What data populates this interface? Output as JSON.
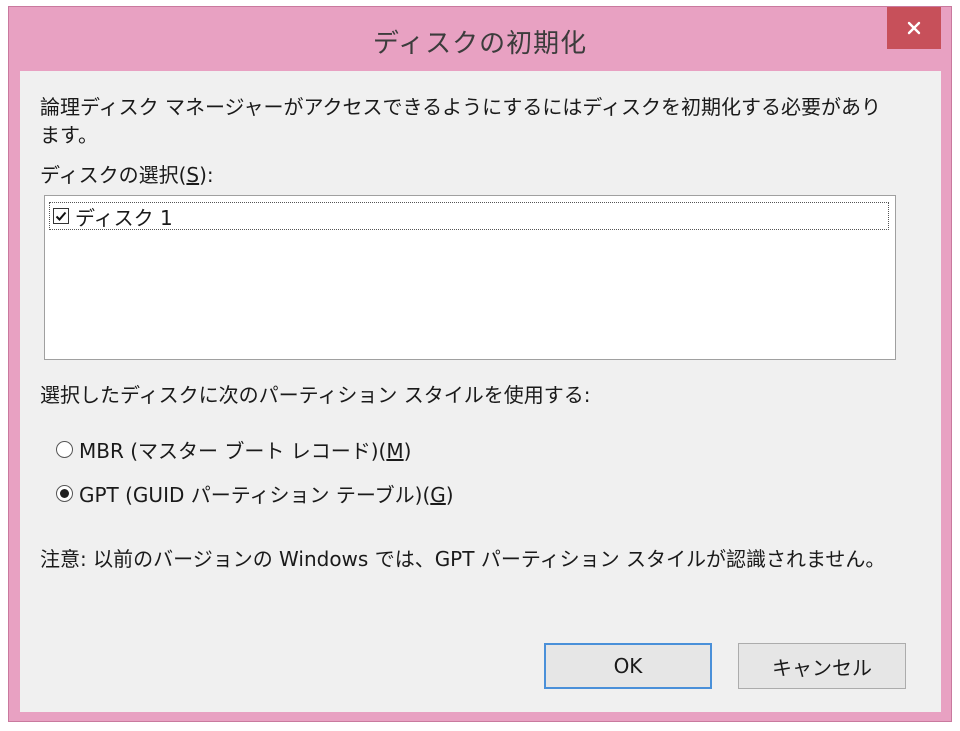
{
  "window": {
    "title": "ディスクの初期化"
  },
  "dialog": {
    "message": "論理ディスク マネージャーがアクセスできるようにするにはディスクを初期化する必要があります。",
    "select_label": "ディスクの選択(",
    "select_label_key": "S",
    "select_label_end": "):",
    "disks": [
      {
        "label": "ディスク 1",
        "checked": true
      }
    ],
    "partition_style_label": "選択したディスクに次のパーティション スタイルを使用する:",
    "options": [
      {
        "label": "MBR (マスター ブート レコード)(",
        "key": "M",
        "end": ")",
        "selected": false
      },
      {
        "label": "GPT (GUID パーティション テーブル)(",
        "key": "G",
        "end": ")",
        "selected": true
      }
    ],
    "note": "注意: 以前のバージョンの Windows では、GPT パーティション スタイルが認識されません。",
    "ok_label": "OK",
    "cancel_label": "キャンセル"
  },
  "colors": {
    "frame": "#e8a1c2",
    "close": "#c7505a",
    "client": "#f0f0f0",
    "focus": "#4a90d9"
  }
}
